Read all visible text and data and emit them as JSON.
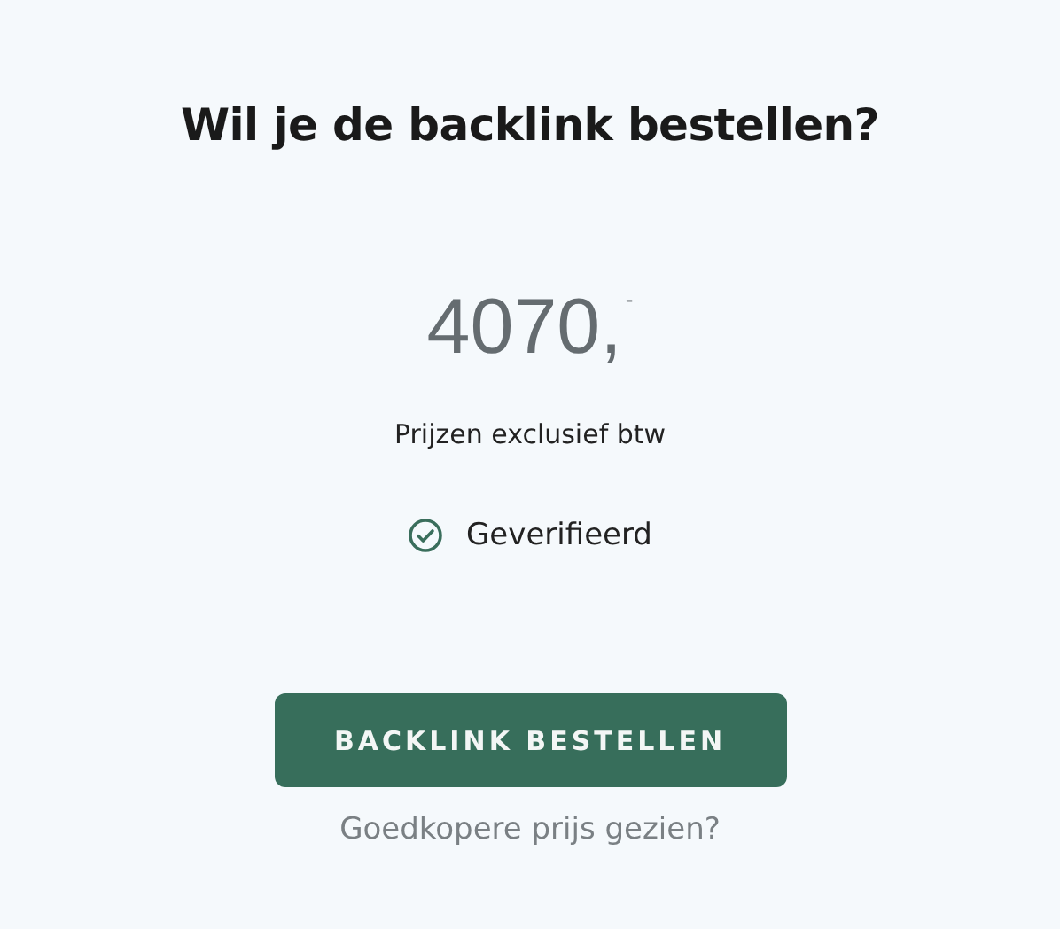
{
  "title": "Wil je de backlink bestellen?",
  "price": {
    "amount": "4070,",
    "cents": "-"
  },
  "price_note": "Prijzen exclusief btw",
  "verification": {
    "label": "Geverifieerd",
    "verified": true
  },
  "order_button": "BACKLINK BESTELLEN",
  "cheaper_link": "Goedkopere prijs gezien?"
}
